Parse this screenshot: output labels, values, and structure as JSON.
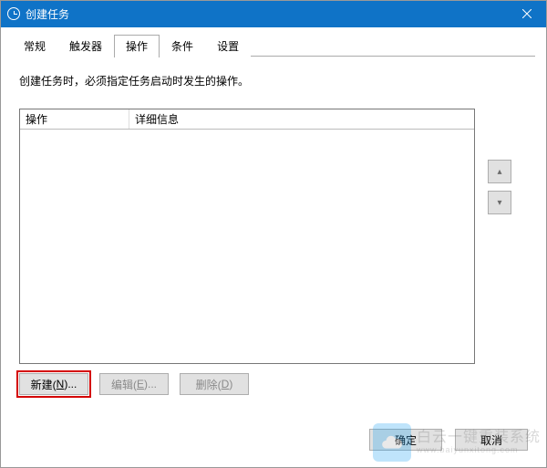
{
  "window": {
    "title": "创建任务"
  },
  "tabs": {
    "general": "常规",
    "triggers": "触发器",
    "actions": "操作",
    "conditions": "条件",
    "settings": "设置"
  },
  "pane": {
    "instruction": "创建任务时，必须指定任务启动时发生的操作。",
    "columns": {
      "action": "操作",
      "details": "详细信息"
    },
    "buttons": {
      "new_prefix": "新建(",
      "new_key": "N",
      "new_suffix": ")...",
      "edit_prefix": "编辑(",
      "edit_key": "E",
      "edit_suffix": ")...",
      "delete_prefix": "删除(",
      "delete_key": "D",
      "delete_suffix": ")"
    },
    "arrows": {
      "up": "▴",
      "down": "▾"
    }
  },
  "footer": {
    "ok": "确定",
    "cancel": "取消"
  },
  "watermark": {
    "line1": "白云一键重装系统",
    "line2": "www.baiyunxitong.com"
  }
}
